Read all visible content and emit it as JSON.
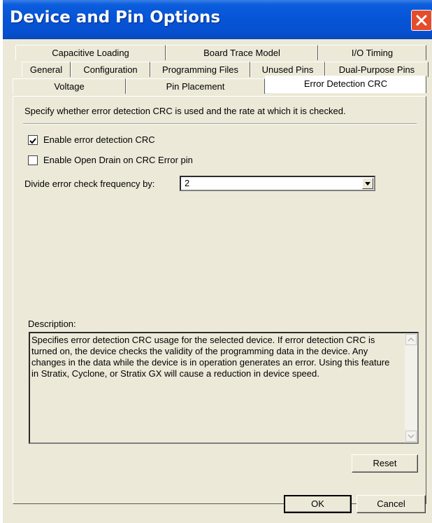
{
  "window": {
    "title": "Device and Pin Options",
    "close_icon": "close-icon"
  },
  "tabs": {
    "row1": [
      "Capacitive Loading",
      "Board Trace Model",
      "I/O Timing"
    ],
    "row2": [
      "General",
      "Configuration",
      "Programming Files",
      "Unused Pins",
      "Dual-Purpose Pins"
    ],
    "row3": [
      "Voltage",
      "Pin Placement",
      "Error Detection CRC"
    ],
    "active": "Error Detection CRC"
  },
  "content": {
    "intro": "Specify whether error detection CRC is used and the rate at which it is checked.",
    "enable_crc": {
      "label": "Enable error detection CRC",
      "checked": true
    },
    "open_drain": {
      "label": "Enable Open Drain on CRC Error pin",
      "checked": false
    },
    "divide": {
      "label": "Divide error check frequency by:",
      "value": "2"
    },
    "description_label": "Description:",
    "description_text": "Specifies error detection CRC usage for the selected device. If error detection CRC is turned on, the device checks the validity of the programming data in the device. Any changes in the data while the device is in operation generates an error. Using this feature in Stratix, Cyclone, or Stratix GX will cause a reduction in device speed.",
    "reset_label": "Reset"
  },
  "footer": {
    "ok_label": "OK",
    "cancel_label": "Cancel"
  }
}
